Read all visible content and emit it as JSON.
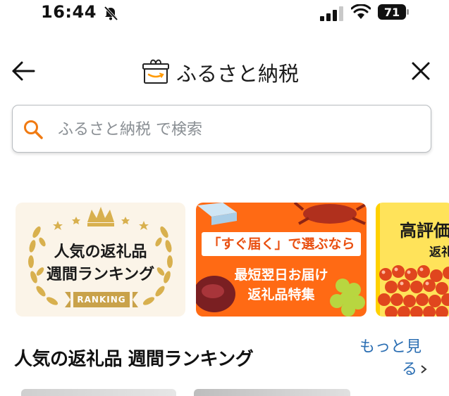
{
  "status_bar": {
    "time": "16:44",
    "battery": "71"
  },
  "header": {
    "title": "ふるさと納税"
  },
  "search": {
    "placeholder": "ふるさと納税 で検索"
  },
  "banners": [
    {
      "line1": "人気の返礼品",
      "line2": "週間ランキング",
      "badge": "RANKING"
    },
    {
      "pill": "「すぐ届く」で選ぶなら",
      "line2": "最短翌日お届け",
      "line3": "返礼品特集"
    },
    {
      "line1": "高評価",
      "line2": "返礼"
    }
  ],
  "section": {
    "title": "人気の返礼品 週間ランキング",
    "more_line1": "もっと見",
    "more_line2": "る"
  },
  "colors": {
    "accent": "#ff6a14",
    "link": "#2c6fb3",
    "gold": "#c9a24a"
  }
}
